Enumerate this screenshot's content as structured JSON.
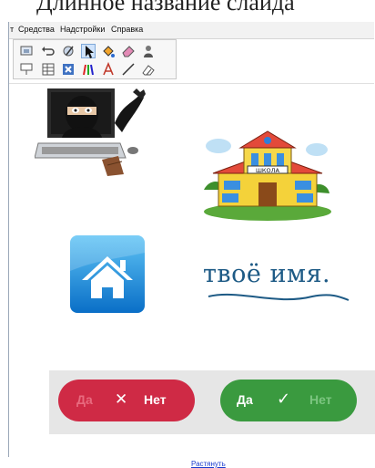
{
  "caption": "Длинное название слайда",
  "menu": [
    {
      "label": "т"
    },
    {
      "label": "Средства"
    },
    {
      "label": "Надстройки"
    },
    {
      "label": "Справка"
    }
  ],
  "toolbar_icons": [
    "screen-capture-icon",
    "undo-icon",
    "magic-pen-icon",
    "select-cursor-icon",
    "fill-icon",
    "eraser-icon",
    "person-icon",
    "screen-shade-icon",
    "table-icon",
    "close-box-icon",
    "pens-icon",
    "text-icon",
    "line-icon",
    "shape-eraser-icon"
  ],
  "canvas": {
    "word_art": "твоё имя.",
    "school_sign": "ШКОЛА",
    "no_button": {
      "left_label": "Да",
      "right_label": "Нет",
      "color": "#cf2a45"
    },
    "yes_button": {
      "left_label": "Да",
      "right_label": "Нет",
      "color": "#3a9a3f"
    },
    "stretch_link": "Растянуть"
  }
}
